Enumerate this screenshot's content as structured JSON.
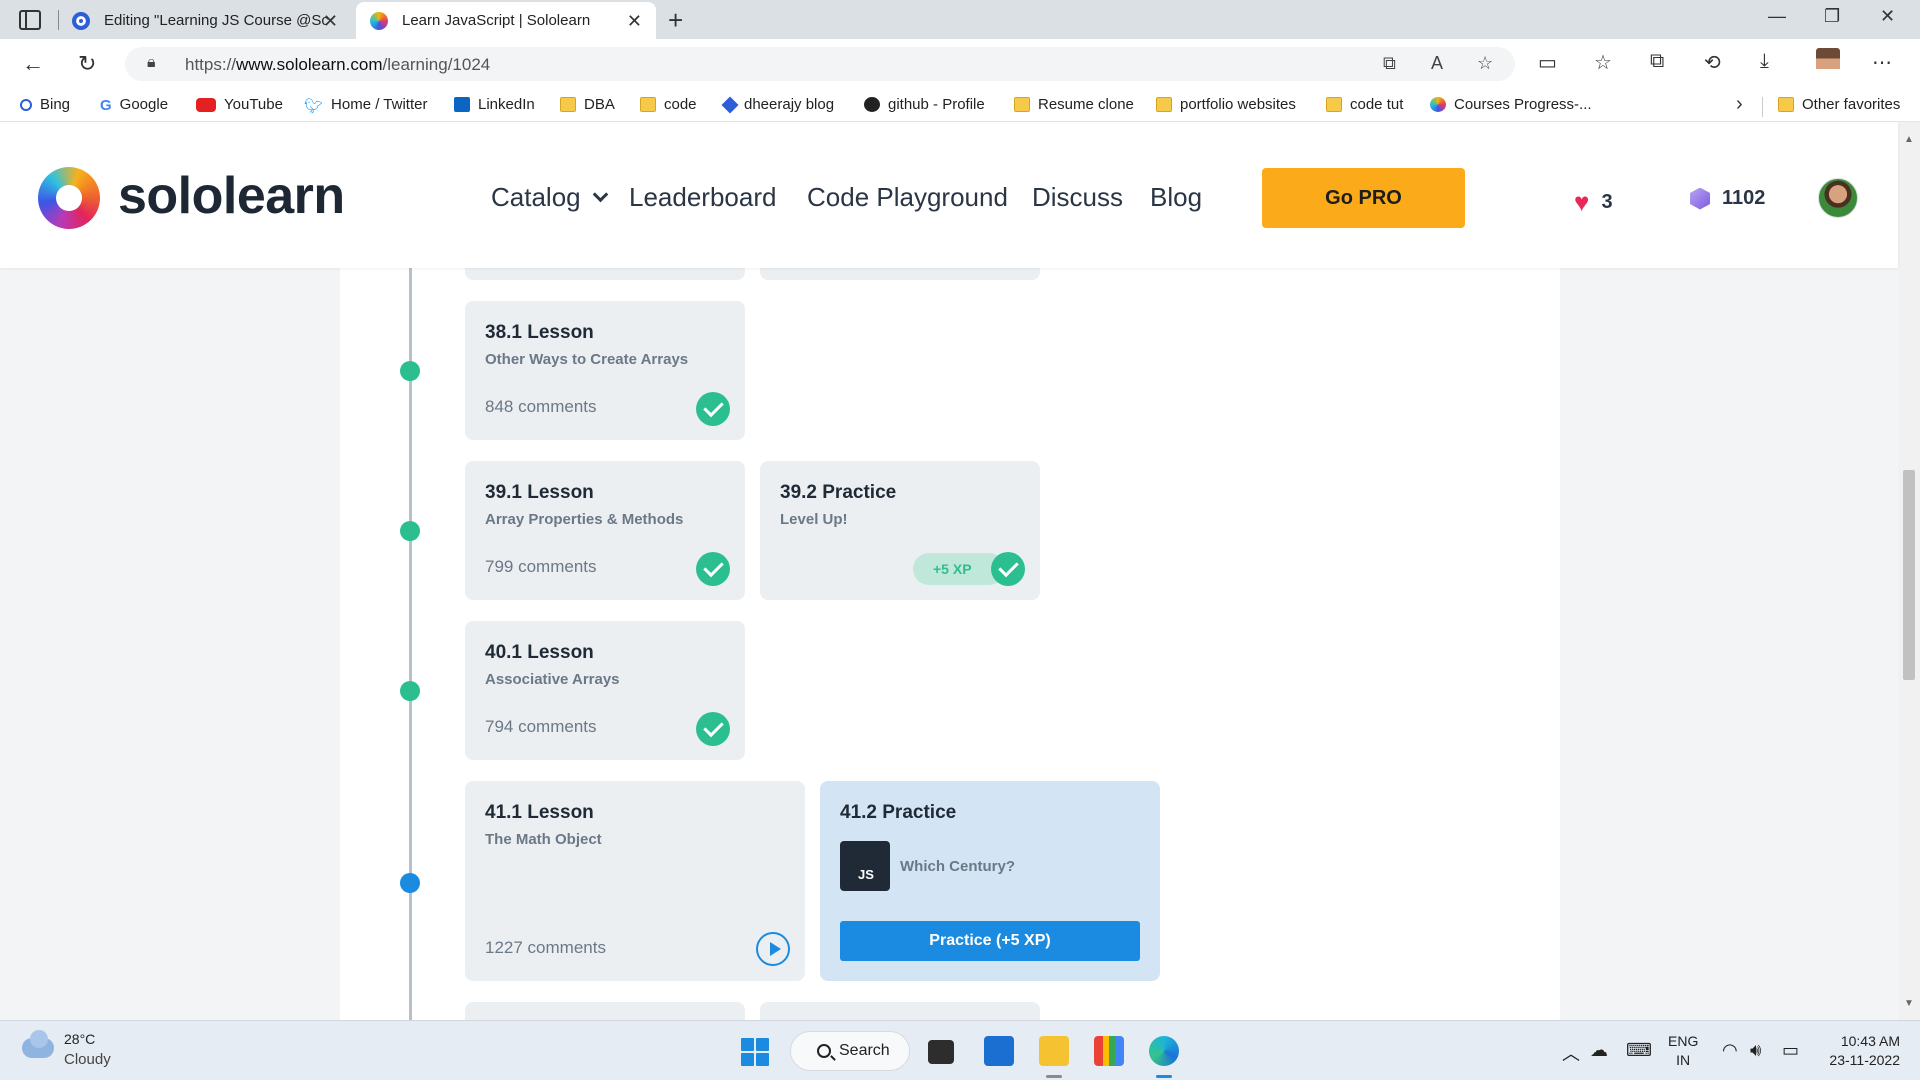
{
  "browser": {
    "tabs": [
      {
        "title": "Editing \"Learning JS Course @Sc",
        "active": false
      },
      {
        "title": "Learn JavaScript | Sololearn",
        "active": true
      }
    ],
    "url_prefix": "https://",
    "url_host": "www.sololearn.com",
    "url_path": "/learning/1024",
    "bookmarks": [
      {
        "label": "Bing",
        "icon": "bing-icon"
      },
      {
        "label": "Google",
        "icon": "google-icon"
      },
      {
        "label": "YouTube",
        "icon": "youtube-icon"
      },
      {
        "label": "Home / Twitter",
        "icon": "twitter-icon"
      },
      {
        "label": "LinkedIn",
        "icon": "linkedin-icon"
      },
      {
        "label": "DBA",
        "icon": "folder-icon"
      },
      {
        "label": "code",
        "icon": "folder-icon"
      },
      {
        "label": "dheerajy blog",
        "icon": "blog-icon"
      },
      {
        "label": "github - Profile",
        "icon": "github-icon"
      },
      {
        "label": "Resume clone",
        "icon": "folder-icon"
      },
      {
        "label": "portfolio websites",
        "icon": "folder-icon"
      },
      {
        "label": "code tut",
        "icon": "folder-icon"
      },
      {
        "label": "Courses Progress-...",
        "icon": "sololearn-icon"
      }
    ],
    "other_favorites": "Other favorites"
  },
  "header": {
    "logo": "sololearn",
    "nav": [
      "Catalog",
      "Leaderboard",
      "Code Playground",
      "Discuss",
      "Blog"
    ],
    "go_pro": "Go PRO",
    "hearts": "3",
    "bits": "1102"
  },
  "lessons": [
    {
      "title": "38.1 Lesson",
      "subtitle": "Other Ways to Create Arrays",
      "comments": "848 comments",
      "status": "completed"
    },
    {
      "title": "39.1 Lesson",
      "subtitle": "Array Properties & Methods",
      "comments": "799 comments",
      "status": "completed"
    },
    {
      "title": "39.2 Practice",
      "subtitle": "Level Up!",
      "xp": "+5 XP",
      "status": "completed"
    },
    {
      "title": "40.1 Lesson",
      "subtitle": "Associative Arrays",
      "comments": "794 comments",
      "status": "completed"
    },
    {
      "title": "41.1 Lesson",
      "subtitle": "The Math Object",
      "comments": "1227 comments",
      "status": "current"
    },
    {
      "title": "41.2 Practice",
      "js_badge": "JS",
      "practice_name": "Which Century?",
      "button": "Practice (+5 XP)",
      "status": "active"
    }
  ],
  "taskbar": {
    "temperature": "28°C",
    "weather": "Cloudy",
    "search": "Search",
    "lang_top": "ENG",
    "lang_bottom": "IN",
    "time": "10:43 AM",
    "date": "23-11-2022"
  },
  "colors": {
    "brand_orange": "#fbaa19",
    "complete_green": "#2bbf8f",
    "active_blue": "#1a8be0",
    "active_card_bg": "#d3e5f5"
  }
}
